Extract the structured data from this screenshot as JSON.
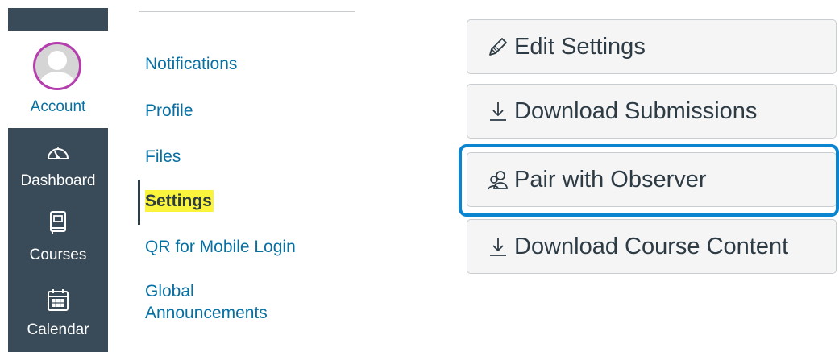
{
  "global_nav": {
    "account": {
      "label": "Account",
      "icon": "avatar"
    },
    "items": [
      {
        "label": "Dashboard",
        "icon": "dashboard-icon"
      },
      {
        "label": "Courses",
        "icon": "courses-icon"
      },
      {
        "label": "Calendar",
        "icon": "calendar-icon"
      }
    ]
  },
  "sub_nav": {
    "items": [
      {
        "label": "Notifications"
      },
      {
        "label": "Profile"
      },
      {
        "label": "Files"
      },
      {
        "label": "Settings",
        "active": true
      },
      {
        "label": "QR for Mobile Login"
      },
      {
        "label": "Global Announcements",
        "line1": "Global",
        "line2": "Announcements"
      }
    ]
  },
  "actions": {
    "buttons": [
      {
        "label": "Edit Settings",
        "icon": "pencil-icon"
      },
      {
        "label": "Download Submissions",
        "icon": "download-icon"
      },
      {
        "label": "Pair with Observer",
        "icon": "observer-icon",
        "focused": true
      },
      {
        "label": "Download Course Content",
        "icon": "download-icon"
      }
    ]
  },
  "colors": {
    "nav_background": "#394b58",
    "link": "#0770a3",
    "active_highlight": "#fbf43c",
    "focus_ring": "#0b85d0",
    "avatar_border": "#b53dae"
  }
}
